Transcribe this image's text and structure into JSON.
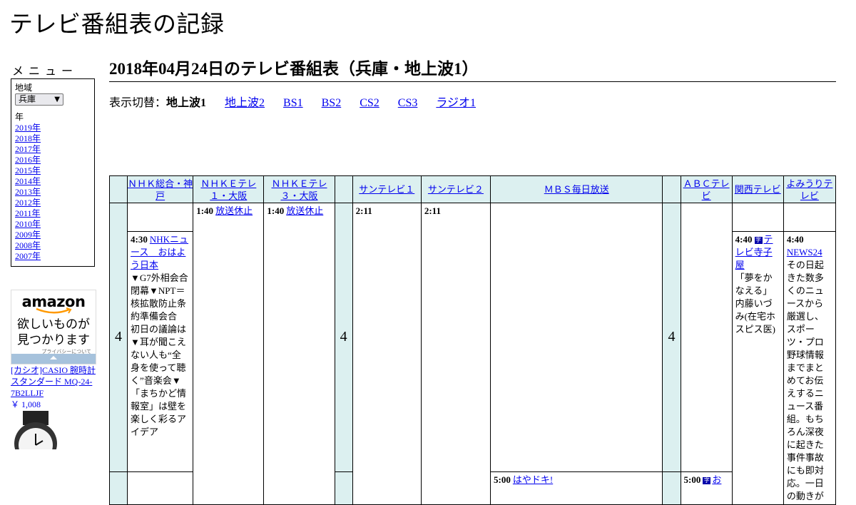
{
  "site": {
    "title": "テレビ番組表の記録"
  },
  "menu": {
    "heading": "メニュー",
    "region_label": "地域",
    "region_selected": "兵庫",
    "year_label": "年",
    "years": [
      "2019年",
      "2018年",
      "2017年",
      "2016年",
      "2015年",
      "2014年",
      "2013年",
      "2012年",
      "2011年",
      "2010年",
      "2009年",
      "2008年",
      "2007年"
    ]
  },
  "ad": {
    "logo": "amazon",
    "text_line1": "欲しいものが",
    "text_line2": "見つかります",
    "privacy": "プライバシーについて",
    "product_title": "[カシオ]CASIO 腕時計 スタンダード MQ-24-7B2LLJF",
    "product_price": "￥ 1,008"
  },
  "page": {
    "heading": "2018年04月24日のテレビ番組表（兵庫・地上波1）",
    "switch_label": "表示切替：",
    "switch_current": "地上波1",
    "switch_links": [
      "地上波2",
      "BS1",
      "BS2",
      "CS2",
      "CS3",
      "ラジオ1"
    ]
  },
  "table": {
    "channels": [
      "ＮＨＫ総合・神戸",
      "ＮＨＫＥテレ１・大阪",
      "ＮＨＫＥテレ３・大阪",
      "サンテレビ１",
      "サンテレビ２",
      "ＭＢＳ毎日放送",
      "ＡＢＣテレビ",
      "関西テレビ",
      "よみうりテレビ"
    ],
    "hour": "4",
    "programs": {
      "nhk_sogo": {
        "time": "4:30",
        "title": "NHKニュース　おはよう日本",
        "desc": "▼G7外相会合　閉幕▼NPT＝核拡散防止条約準備会合　初日の議論は▼耳が聞こえない人も“全身を使って聴く”音楽会▼「まちかど情報室」は壁を楽しく彩るアイデア"
      },
      "etele1": {
        "time": "1:40",
        "title": "放送休止"
      },
      "etele3": {
        "time": "1:40",
        "title": "放送休止"
      },
      "sun1": {
        "time": "2:11"
      },
      "sun2": {
        "time": "2:11"
      },
      "mbs": {
        "time": "5:00",
        "title": "はやドキ!"
      },
      "abc": {
        "time": "5:00",
        "title": "お"
      },
      "ktv": {
        "time": "4:40",
        "title": "テレビ寺子屋",
        "desc": "「夢をかなえる」内藤いづみ(在宅ホスピス医)"
      },
      "ytv": {
        "time": "4:40",
        "title": "NEWS24",
        "desc": "その日起きた数多くのニュースから厳選し、スポーツ・プロ野球情報までまとめてお伝えするニュース番組。もちろん深夜に起きた事件事故にも即対応。一日の動きが"
      }
    }
  }
}
